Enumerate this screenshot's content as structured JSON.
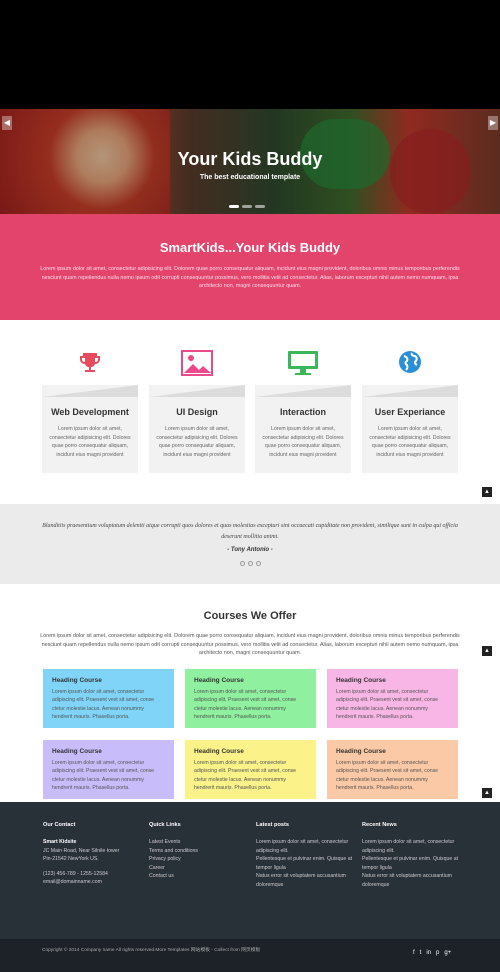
{
  "hero": {
    "title": "Your Kids Buddy",
    "subtitle": "The best educational template",
    "prev_icon": "chevron-left-icon",
    "next_icon": "chevron-right-icon"
  },
  "intro": {
    "heading": "SmartKids...Your Kids Buddy",
    "text": "Lorem ipsum dolor sit amet, consectetur adipisicing elit. Dolorem quae porro consequatur aliquam, incidunt eius magni provident, doloribus omnis minus temporibus perferendis nesciunt quam repellendus nulla nemo ipsum odit corrupti consequuntur possimus, vero mollitia velit ad consectetur. Alias, laborum excepturi nihil autem nemo numquam, ipsa architecto non, magni consequuntur quam."
  },
  "scroll_top_icon": "chevron-up-icon",
  "services": [
    {
      "icon": "trophy-icon",
      "title": "Web Development",
      "text": "Lorem ipsum dolor sit amet, consectetur adipisicing elit. Dolores quae porro consequatur aliquam, incidunt eius magni provident"
    },
    {
      "icon": "image-icon",
      "title": "UI Design",
      "text": "Lorem ipsum dolor sit amet, consectetur adipisicing elit. Dolores quae porro consequatur aliquam, incidunt eius magni provident"
    },
    {
      "icon": "monitor-icon",
      "title": "Interaction",
      "text": "Lorem ipsum dolor sit amet, consectetur adipisicing elit. Dolores quae porro consequatur aliquam, incidunt eius magni provident"
    },
    {
      "icon": "globe-icon",
      "title": "User Experiance",
      "text": "Lorem ipsum dolor sit amet, consectetur adipisicing elit. Dolores quae porro consequatur aliquam, incidunt eius magni provident"
    }
  ],
  "testimonial": {
    "quote": "Blanditiis praesentium voluptatum deleniti atque corrupti quos dolores et quas molestias excepturi sint occaecati cupiditate non provident, similique sunt in culpa qui officia deserunt mollitia animi.",
    "author": "- Tony Antonio -"
  },
  "courses": {
    "heading": "Courses We Offer",
    "lead": "Lorem ipsum dolor sit amet, consectetur adipisicing elit. Dolorem quae porro consequatur aliquam, incidunt eius magni provident, doloribus omnis minus temporibus perferendis nesciunt quam repellendus nulla nemo ipsum odit corrupti consequuntur possimus, vero mollitia velit ad consectetur. Alias, laborum excepturi nihil autem nemo numquam, ipsa architecto non, magni consequuntur quam.",
    "items": [
      {
        "title": "Heading Course",
        "text": "Lorem ipsum dolor sit amet, consectetur adipiscing elit. Praesent vest sit amet, conse ctetur molestie lacus. Aenean nonummy hendrerit mauris. Phasellus porta.",
        "color": "#7fd4f7"
      },
      {
        "title": "Heading Course",
        "text": "Lorem ipsum dolor sit amet, consectetur adipiscing elit. Praesent vest sit amet, conse ctetur molestie lacus. Aenean nonummy hendrerit mauris. Phasellus porta.",
        "color": "#8ff0a0"
      },
      {
        "title": "Heading Course",
        "text": "Lorem ipsum dolor sit amet, consectetur adipiscing elit. Praesent vest sit amet, conse ctetur molestie lacus. Aenean nonummy hendrerit mauris. Phasellus porta.",
        "color": "#f7b6e6"
      },
      {
        "title": "Heading Course",
        "text": "Lorem ipsum dolor sit amet, consectetur adipiscing elit. Praesent vest sit amet, conse ctetur molestie lacus. Aenean nonummy hendrerit mauris. Phasellus porta.",
        "color": "#c8bdfa"
      },
      {
        "title": "Heading Course",
        "text": "Lorem ipsum dolor sit amet, consectetur adipiscing elit. Praesent vest sit amet, conse ctetur molestie lacus. Aenean nonummy hendrerit mauris. Phasellus porta.",
        "color": "#fbf28a"
      },
      {
        "title": "Heading Course",
        "text": "Lorem ipsum dolor sit amet, consectetur adipiscing elit. Praesent vest sit amet, conse ctetur molestie lacus. Aenean nonummy hendrerit mauris. Phasellus porta.",
        "color": "#fcc9a6"
      }
    ]
  },
  "footer": {
    "contact": {
      "title": "Our Contact",
      "name": "Smart Kidsite",
      "address1": "JC Main Road, Near Silnile tower",
      "address2": "Pin-21542 NewYork US.",
      "phone": "(123) 456-789 - 1255-12584",
      "email": "email@domainname.com"
    },
    "links": {
      "title": "Quick Links",
      "items": [
        "Latest Events",
        "Terms and conditions",
        "Privacy policy",
        "Career",
        "Contact us"
      ]
    },
    "latest": {
      "title": "Latest posts",
      "items": [
        "Lorem ipsum dolor sit amet, consectetur adipiscing elit.",
        "Pellentesque et pulvinar enim. Quisque at tempor ligula",
        "Natus error sit voluptatem accusantium doloremque"
      ]
    },
    "news": {
      "title": "Recent News",
      "items": [
        "Lorem ipsum dolor sit amet, consectetur adipiscing elit.",
        "Pellentesque et pulvinar enim. Quisque at tempor ligula",
        "Natus error sit voluptatem accusantium doloremque"
      ]
    },
    "copyright": "Copyright © 2014 Company name All rights reserved.More Templates 网站模板 - Collect from 网页模板",
    "social": [
      "f",
      "t",
      "in",
      "p",
      "g+"
    ]
  },
  "colors": {
    "pink": "#e2446c",
    "footer": "#283038"
  }
}
